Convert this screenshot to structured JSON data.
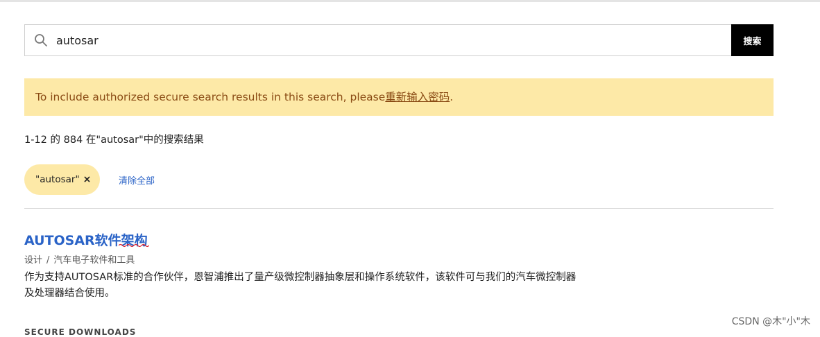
{
  "search": {
    "value": "autosar",
    "button_label": "搜索"
  },
  "notice": {
    "text": "To include authorized secure search results in this search, please",
    "link_text": "重新输入密码",
    "suffix": "."
  },
  "results_summary": "1-12 的 884 在\"autosar\"中的搜索结果",
  "filters": {
    "chip_label": "\"autosar\"",
    "chip_close": "×",
    "clear_all": "清除全部"
  },
  "result": {
    "title": "AUTOSAR软件架构",
    "breadcrumb": [
      "设计",
      "汽车电子软件和工具"
    ],
    "breadcrumb_separator": "/",
    "description": "作为支持AUTOSAR标准的合作伙伴，恩智浦推出了量产级微控制器抽象层和操作系统软件，该软件可与我们的汽车微控制器及处理器结合使用。"
  },
  "downloads_label": "SECURE DOWNLOADS",
  "watermark": "CSDN @木\"小\"木",
  "colors": {
    "notice_bg": "#fde9a7",
    "notice_text": "#8a4b14",
    "link": "#2a63c7",
    "button_bg": "#000000"
  }
}
